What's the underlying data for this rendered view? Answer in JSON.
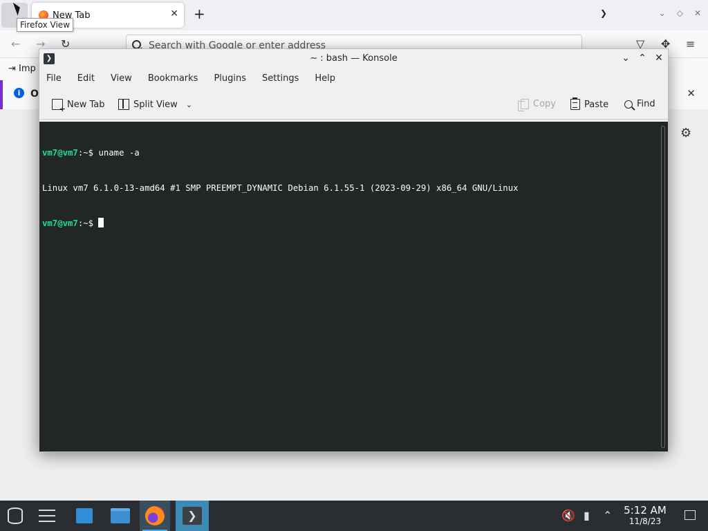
{
  "firefox": {
    "tab_title": "New Tab",
    "tooltip": "Firefox View",
    "url_placeholder": "Search with Google or enter address",
    "bookmark_import": "Imp",
    "notification_text": "O"
  },
  "konsole": {
    "title": "~ : bash — Konsole",
    "menu": [
      "File",
      "Edit",
      "View",
      "Bookmarks",
      "Plugins",
      "Settings",
      "Help"
    ],
    "toolbar": {
      "new_tab": "New Tab",
      "split_view": "Split View",
      "copy": "Copy",
      "paste": "Paste",
      "find": "Find"
    },
    "terminal": {
      "prompt_user": "vm7@vm7",
      "prompt_path": ":~$",
      "command": " uname -a",
      "output": "Linux vm7 6.1.0-13-amd64 #1 SMP PREEMPT_DYNAMIC Debian 6.1.55-1 (2023-09-29) x86_64 GNU/Linux"
    }
  },
  "taskbar": {
    "time": "5:12 AM",
    "date": "11/8/23"
  },
  "colors": {
    "terminal_bg": "#232627",
    "prompt_green": "#1cdc9a",
    "taskbar_bg": "#2a2e32",
    "accent": "#3daee9"
  }
}
